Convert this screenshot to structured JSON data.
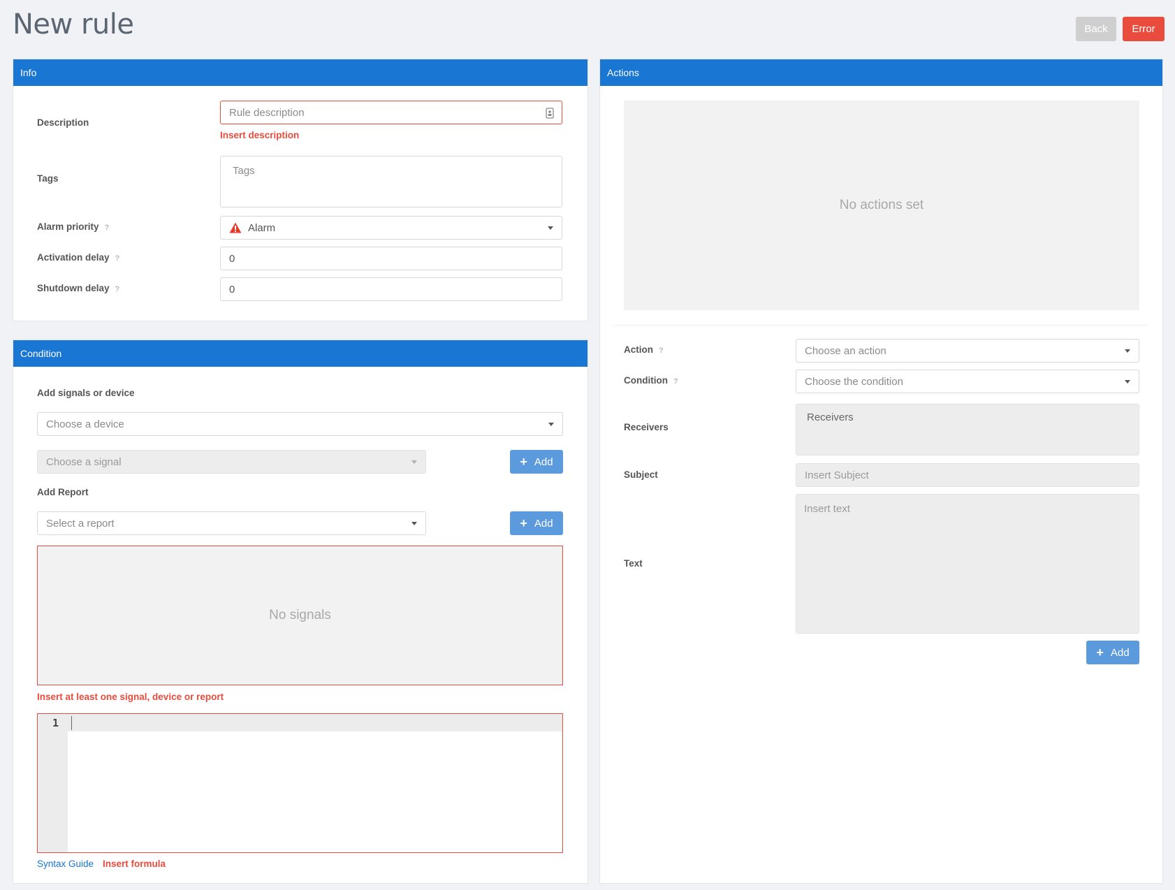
{
  "page": {
    "title": "New rule",
    "back_label": "Back",
    "error_label": "Error"
  },
  "info": {
    "header": "Info",
    "description_label": "Description",
    "description_placeholder": "Rule description",
    "description_error": "Insert description",
    "tags_label": "Tags",
    "tags_placeholder": "Tags",
    "alarm_priority_label": "Alarm priority",
    "alarm_priority_value": "Alarm",
    "activation_delay_label": "Activation delay",
    "activation_delay_value": "0",
    "shutdown_delay_label": "Shutdown delay",
    "shutdown_delay_value": "0",
    "help_glyph": "?"
  },
  "condition": {
    "header": "Condition",
    "add_signals_label": "Add signals or device",
    "device_placeholder": "Choose a device",
    "signal_placeholder": "Choose a signal",
    "add_label": "Add",
    "add_report_label": "Add Report",
    "report_placeholder": "Select a report",
    "no_signals_text": "No signals",
    "signals_error": "Insert at least one signal, device or report",
    "editor_line_number": "1",
    "syntax_guide_label": "Syntax Guide",
    "formula_error": "Insert formula"
  },
  "actions": {
    "header": "Actions",
    "no_actions_text": "No actions set",
    "action_label": "Action",
    "action_placeholder": "Choose an action",
    "condition_label": "Condition",
    "condition_placeholder": "Choose the condition",
    "receivers_label": "Receivers",
    "receivers_placeholder": "Receivers",
    "subject_label": "Subject",
    "subject_placeholder": "Insert Subject",
    "text_label": "Text",
    "text_placeholder": "Insert text",
    "add_label": "Add"
  },
  "colors": {
    "header_blue": "#1976d2",
    "error_red": "#e94b3c",
    "add_button_blue": "#5b9bdd",
    "back_button_grey": "#cfcfcf"
  },
  "icons": {
    "alarm": "warning-triangle-icon",
    "description_field": "contact-card-icon",
    "add": "plus-icon",
    "dropdown": "chevron-down-icon"
  }
}
